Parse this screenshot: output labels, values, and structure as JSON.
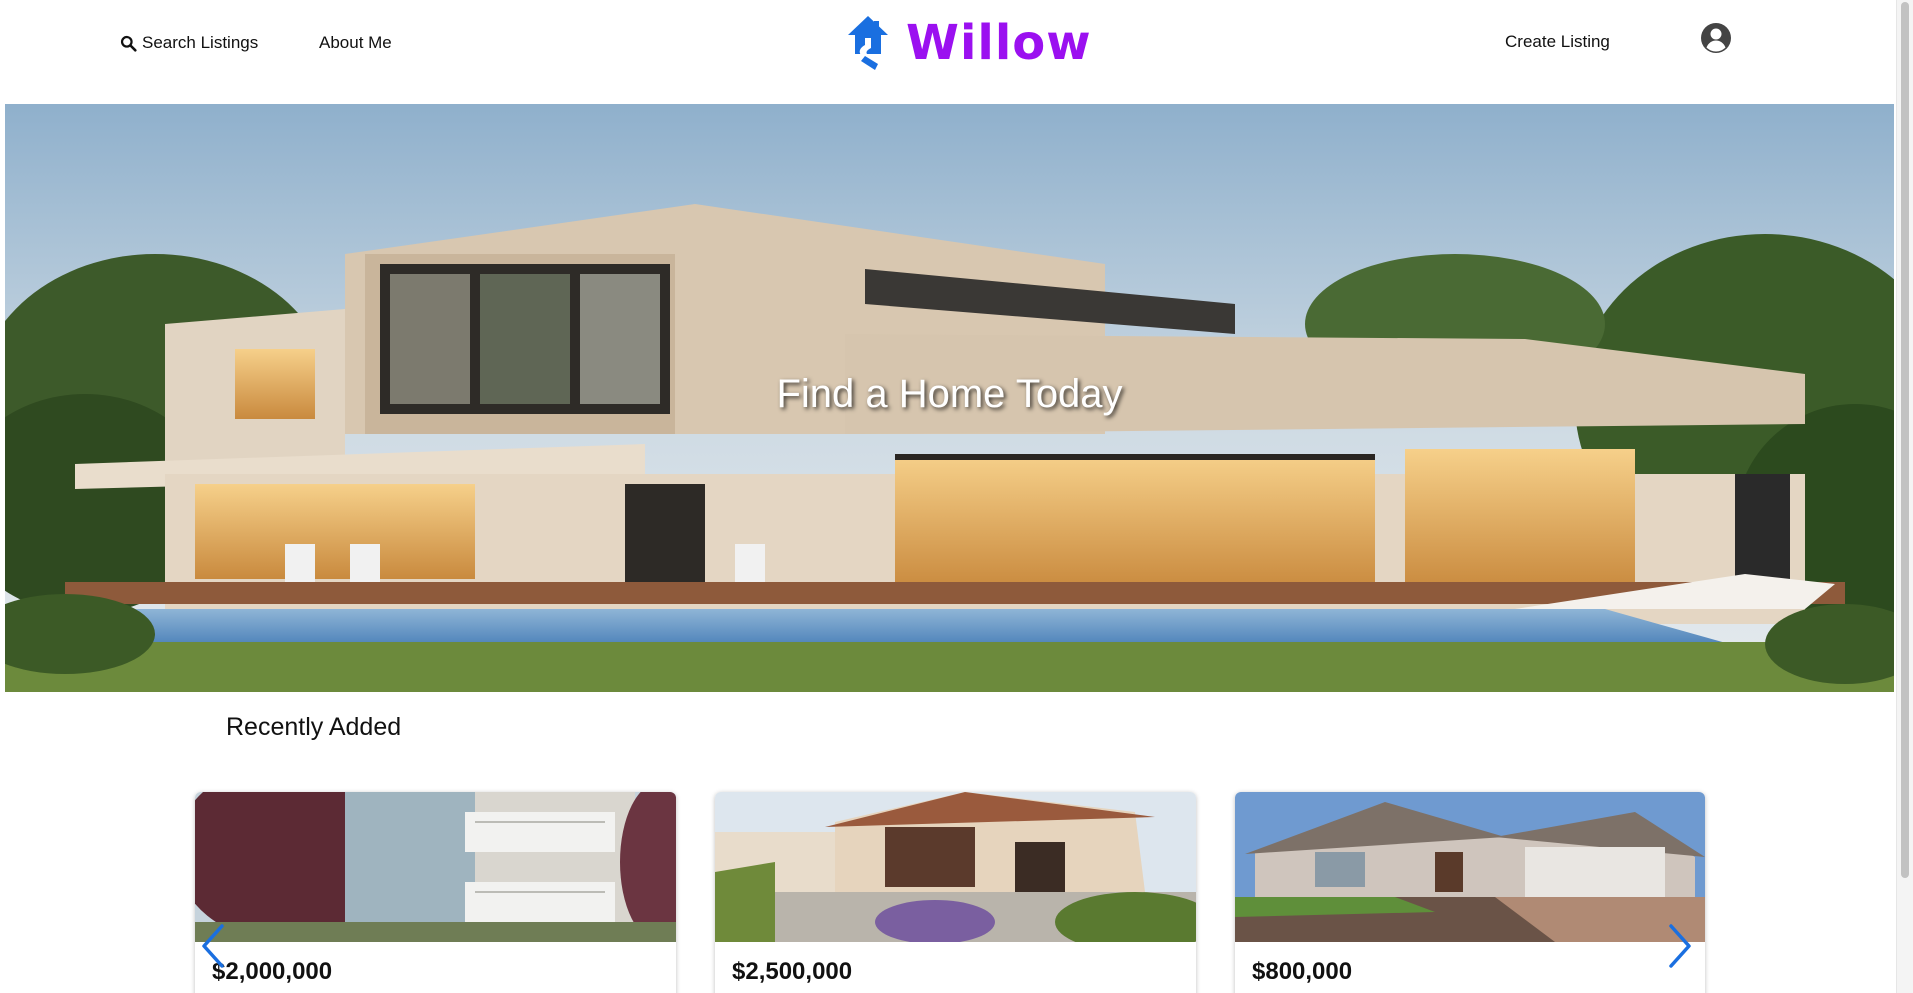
{
  "header": {
    "search_label": "Search Listings",
    "about_label": "About Me",
    "brand_name": "Willow",
    "create_label": "Create Listing",
    "brand_color": "#9b10f0",
    "logo_color": "#1a6fe0"
  },
  "hero": {
    "title": "Find a Home Today"
  },
  "recent": {
    "title": "Recently Added",
    "listings": [
      {
        "price": "$2,000,000"
      },
      {
        "price": "$2,500,000"
      },
      {
        "price": "$800,000"
      }
    ]
  },
  "icons": {
    "search": "search-icon",
    "logo": "house-logo-icon",
    "avatar": "user-avatar-icon",
    "prev": "chevron-left-icon",
    "next": "chevron-right-icon"
  }
}
